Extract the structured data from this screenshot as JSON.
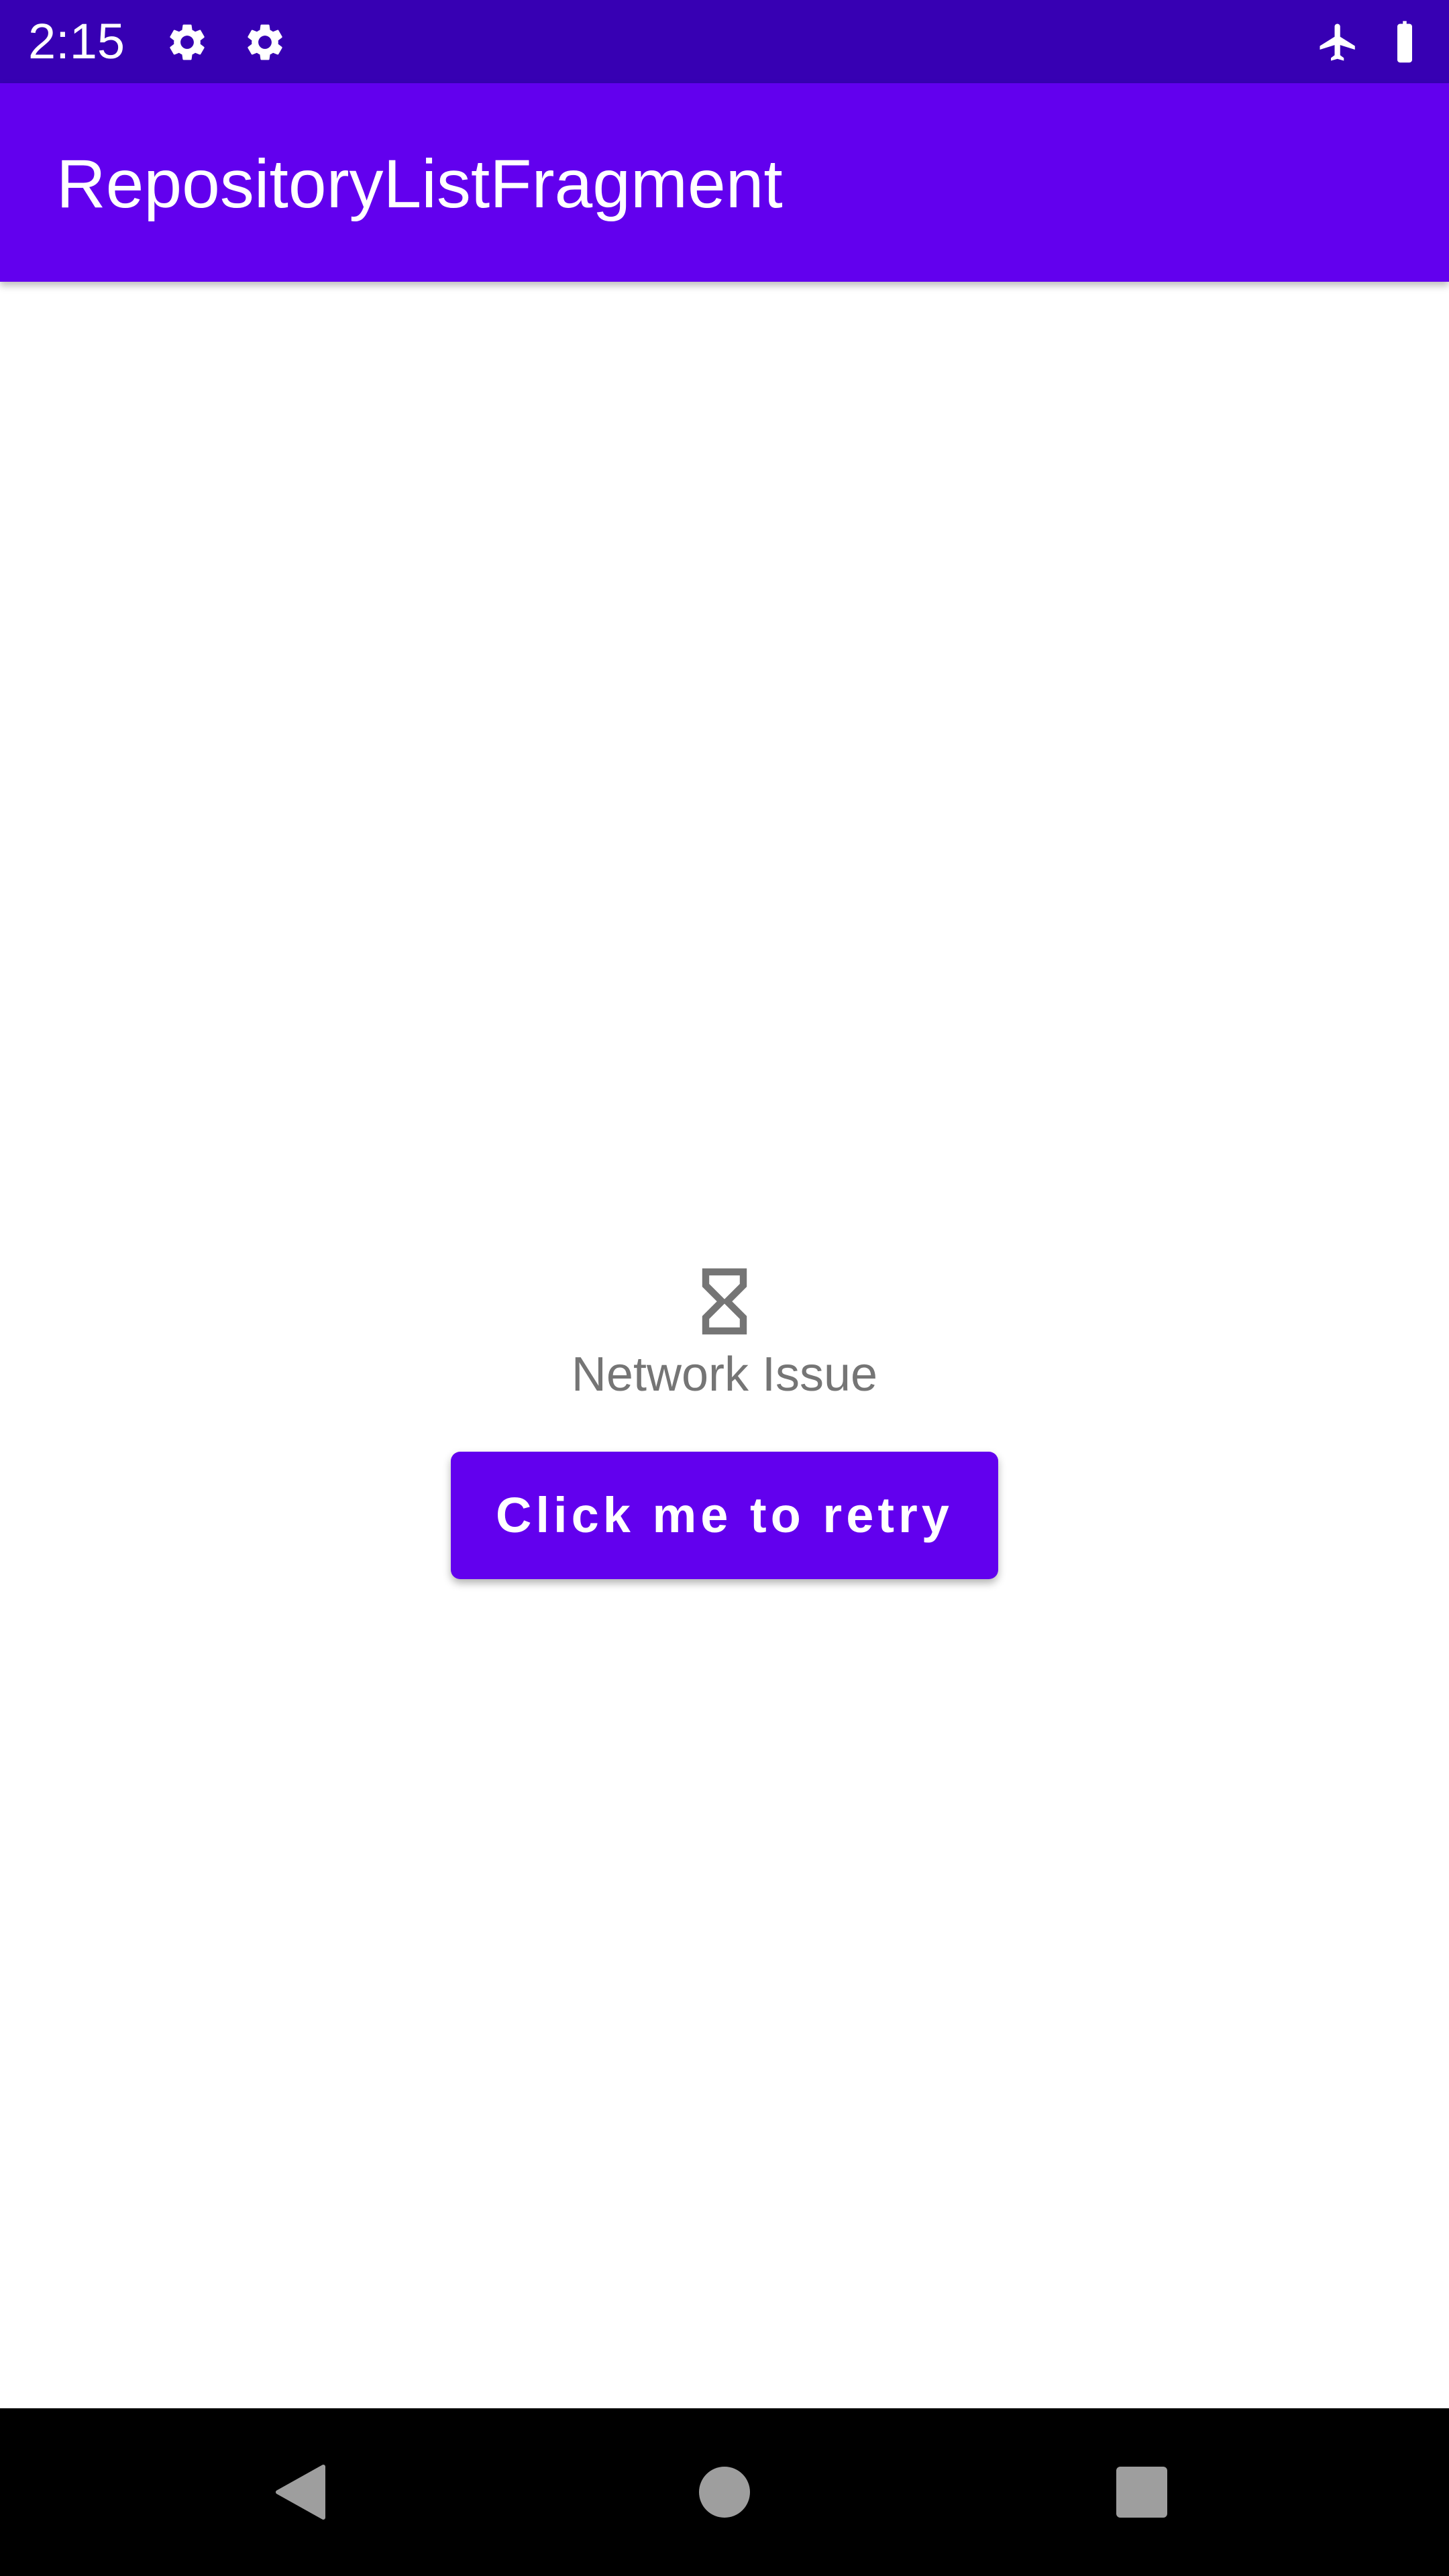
{
  "status_bar": {
    "time": "2:15",
    "icons": [
      "gear-icon",
      "gear-icon",
      "airplane-icon",
      "battery-icon"
    ],
    "background": "#3700b3"
  },
  "app_bar": {
    "title": "RepositoryListFragment",
    "background": "#6200ee"
  },
  "error_state": {
    "icon": "hourglass-icon",
    "message": "Network Issue",
    "retry_label": "Click me to retry",
    "accent": "#6200ee",
    "text_color": "#757575"
  },
  "nav_bar": {
    "buttons": [
      "back-icon",
      "home-icon",
      "recents-icon"
    ],
    "icon_color": "#9e9e9e"
  }
}
